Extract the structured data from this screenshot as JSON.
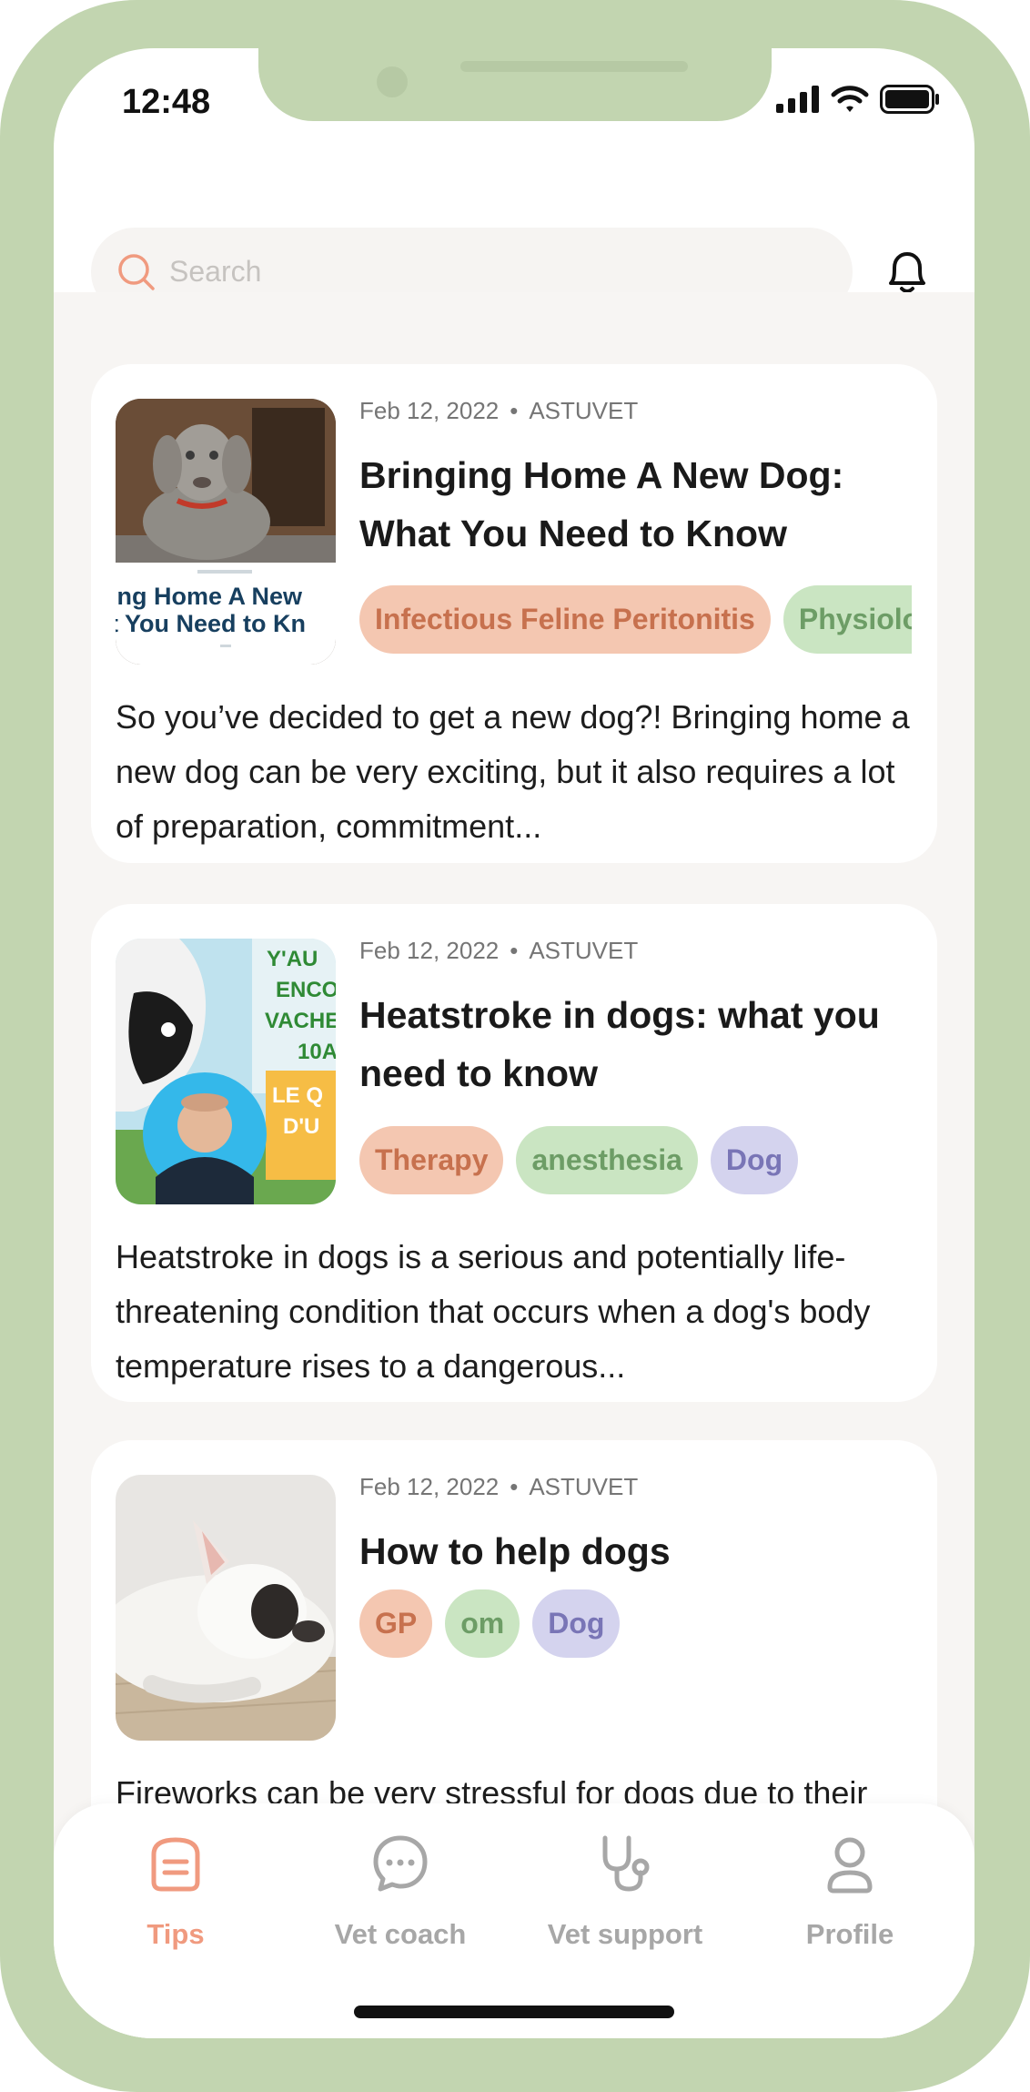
{
  "status_bar": {
    "time": "12:48"
  },
  "search": {
    "placeholder": "Search"
  },
  "colors": {
    "accent": "#f09a7f",
    "frame": "#c2d5b0",
    "tag_orange": "#f4c7b1",
    "tag_green": "#cae5c2",
    "tag_purple": "#d4d3ee"
  },
  "articles": [
    {
      "date": "Feb 12, 2022",
      "separator": "•",
      "source": "ASTUVET",
      "title": "Bringing Home A New Dog: What You Need to Know",
      "thumb_lines": [
        "ing Home A New",
        "t You Need to Kn"
      ],
      "tags": [
        "Infectious Feline Peritonitis",
        "Physiology"
      ],
      "excerpt": "So you’ve decided to get a new dog?! Bringing home a new dog can be very exciting, but it also requires a lot of preparation, commitment..."
    },
    {
      "date": "Feb 12, 2022",
      "separator": "•",
      "source": "ASTUVET",
      "title": "Heatstroke in dogs: what you need to know",
      "thumb_lines": [
        "Y'AU",
        "ENCO",
        "VACHE",
        "10A",
        "LE Q",
        "D'U"
      ],
      "tags": [
        "Therapy",
        "anesthesia",
        "Dog"
      ],
      "excerpt": "Heatstroke in dogs is a serious and potentially life-threatening condition that occurs when a dog's body temperature rises to a dangerous..."
    },
    {
      "date": "Feb 12, 2022",
      "separator": "•",
      "source": "ASTUVET",
      "title": "How to help dogs",
      "tags": [
        "GP",
        "om",
        "Dog"
      ],
      "excerpt": "Fireworks can be very stressful for dogs due to their sensitivity to loud noises"
    }
  ],
  "tabbar": {
    "tabs": [
      {
        "label": "Tips",
        "icon": "tips-icon",
        "active": true
      },
      {
        "label": "Vet coach",
        "icon": "chat-bubble-icon",
        "active": false
      },
      {
        "label": "Vet support",
        "icon": "stethoscope-icon",
        "active": false
      },
      {
        "label": "Profile",
        "icon": "user-icon",
        "active": false
      }
    ]
  }
}
